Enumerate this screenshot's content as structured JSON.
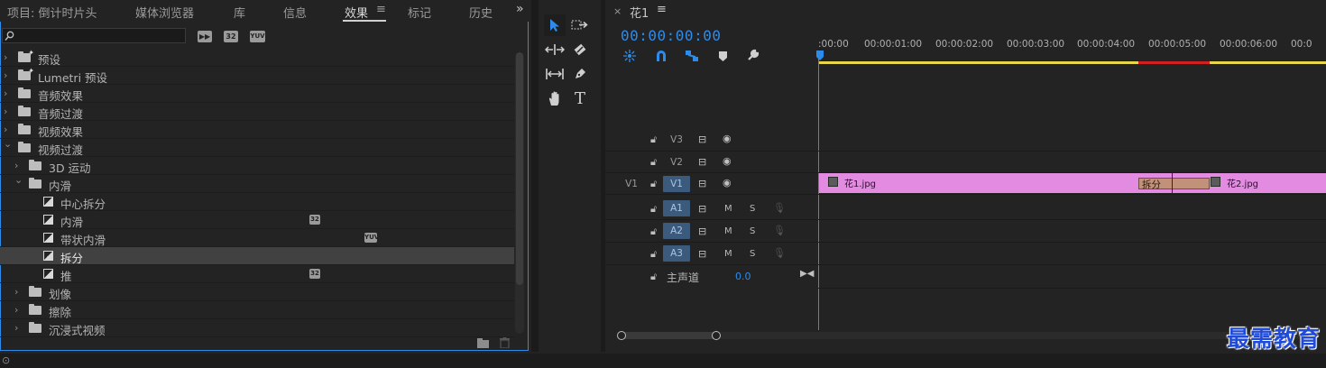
{
  "effects_panel": {
    "tabs": [
      {
        "label": "项目: 倒计时片头"
      },
      {
        "label": "媒体浏览器"
      },
      {
        "label": "库"
      },
      {
        "label": "信息"
      },
      {
        "label": "效果"
      },
      {
        "label": "标记"
      },
      {
        "label": "历史"
      }
    ],
    "active_tab": "效果",
    "search": {
      "value": "",
      "placeholder": ""
    },
    "filter_badges": [
      "32",
      "YUV"
    ],
    "tree": [
      {
        "label": "预设",
        "type": "folder-star",
        "expanded": false
      },
      {
        "label": "Lumetri 预设",
        "type": "folder-star",
        "expanded": false
      },
      {
        "label": "音频效果",
        "type": "folder",
        "expanded": false
      },
      {
        "label": "音频过渡",
        "type": "folder",
        "expanded": false
      },
      {
        "label": "视频效果",
        "type": "folder",
        "expanded": false
      },
      {
        "label": "视频过渡",
        "type": "folder",
        "expanded": true
      },
      {
        "label": "3D 运动",
        "type": "folder",
        "expanded": false
      },
      {
        "label": "内滑",
        "type": "folder",
        "expanded": true
      },
      {
        "label": "中心拆分",
        "type": "effect"
      },
      {
        "label": "内滑",
        "type": "effect",
        "badge": "32"
      },
      {
        "label": "带状内滑",
        "type": "effect",
        "badge": "YUV"
      },
      {
        "label": "拆分",
        "type": "effect",
        "selected": true
      },
      {
        "label": "推",
        "type": "effect",
        "badge": "32"
      },
      {
        "label": "划像",
        "type": "folder",
        "expanded": false
      },
      {
        "label": "擦除",
        "type": "folder",
        "expanded": false
      },
      {
        "label": "沉浸式视频",
        "type": "folder",
        "expanded": false
      }
    ]
  },
  "timeline": {
    "sequence_tab": "花1",
    "timecode": "00:00:00:00",
    "ruler_labels": [
      ":00:00",
      "00:00:01:00",
      "00:00:02:00",
      "00:00:03:00",
      "00:00:04:00",
      "00:00:05:00",
      "00:00:06:00",
      "00:0"
    ],
    "video_tracks": [
      {
        "source": "",
        "name": "V3"
      },
      {
        "source": "",
        "name": "V2"
      },
      {
        "source": "V1",
        "name": "V1"
      }
    ],
    "audio_tracks": [
      {
        "name": "A1",
        "mute": "M",
        "solo": "S"
      },
      {
        "name": "A2",
        "mute": "M",
        "solo": "S"
      },
      {
        "name": "A3",
        "mute": "M",
        "solo": "S"
      }
    ],
    "master": {
      "label": "主声道",
      "value": "0.0"
    },
    "clips": [
      {
        "name": "花1.jpg",
        "color": "#e28be0"
      },
      {
        "name": "花2.jpg",
        "color": "#e28be0"
      }
    ],
    "transition": {
      "name": "拆分"
    }
  },
  "watermark": "最需教育",
  "colors": {
    "accent": "#2d8ceb",
    "clip": "#e28be0",
    "track_target": "#3b5a7c",
    "work_area": "#e8d64a",
    "render_red": "#d12020"
  }
}
